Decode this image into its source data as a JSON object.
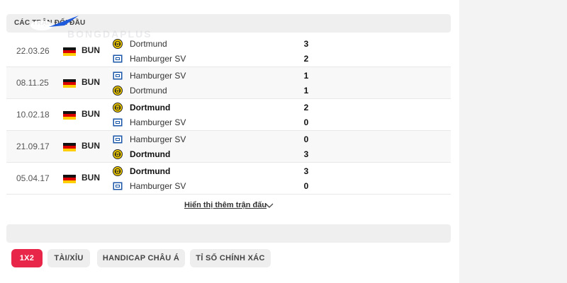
{
  "header": {
    "title": "CÁC TRẬN ĐỐI ĐẦU",
    "watermark": "BONGDAPLUS"
  },
  "colors": {
    "accent": "#e8264a"
  },
  "matches": [
    {
      "date": "22.03.26",
      "league": "BUN",
      "home": "Dortmund",
      "away": "Hamburger SV",
      "home_score": "3",
      "away_score": "2",
      "home_bold": false,
      "away_bold": false
    },
    {
      "date": "08.11.25",
      "league": "BUN",
      "home": "Hamburger SV",
      "away": "Dortmund",
      "home_score": "1",
      "away_score": "1",
      "home_bold": false,
      "away_bold": false
    },
    {
      "date": "10.02.18",
      "league": "BUN",
      "home": "Dortmund",
      "away": "Hamburger SV",
      "home_score": "2",
      "away_score": "0",
      "home_bold": true,
      "away_bold": false
    },
    {
      "date": "21.09.17",
      "league": "BUN",
      "home": "Hamburger SV",
      "away": "Dortmund",
      "home_score": "0",
      "away_score": "3",
      "home_bold": false,
      "away_bold": true
    },
    {
      "date": "05.04.17",
      "league": "BUN",
      "home": "Dortmund",
      "away": "Hamburger SV",
      "home_score": "3",
      "away_score": "0",
      "home_bold": true,
      "away_bold": false
    }
  ],
  "show_more": "Hiển thị thêm trận đấu",
  "tabs": [
    {
      "label": "1X2",
      "active": true
    },
    {
      "label": "TÀI/XỈU",
      "active": false
    },
    {
      "label": "HANDICAP CHÂU Á",
      "active": false
    },
    {
      "label": "TỈ SỐ CHÍNH XÁC",
      "active": false
    }
  ]
}
